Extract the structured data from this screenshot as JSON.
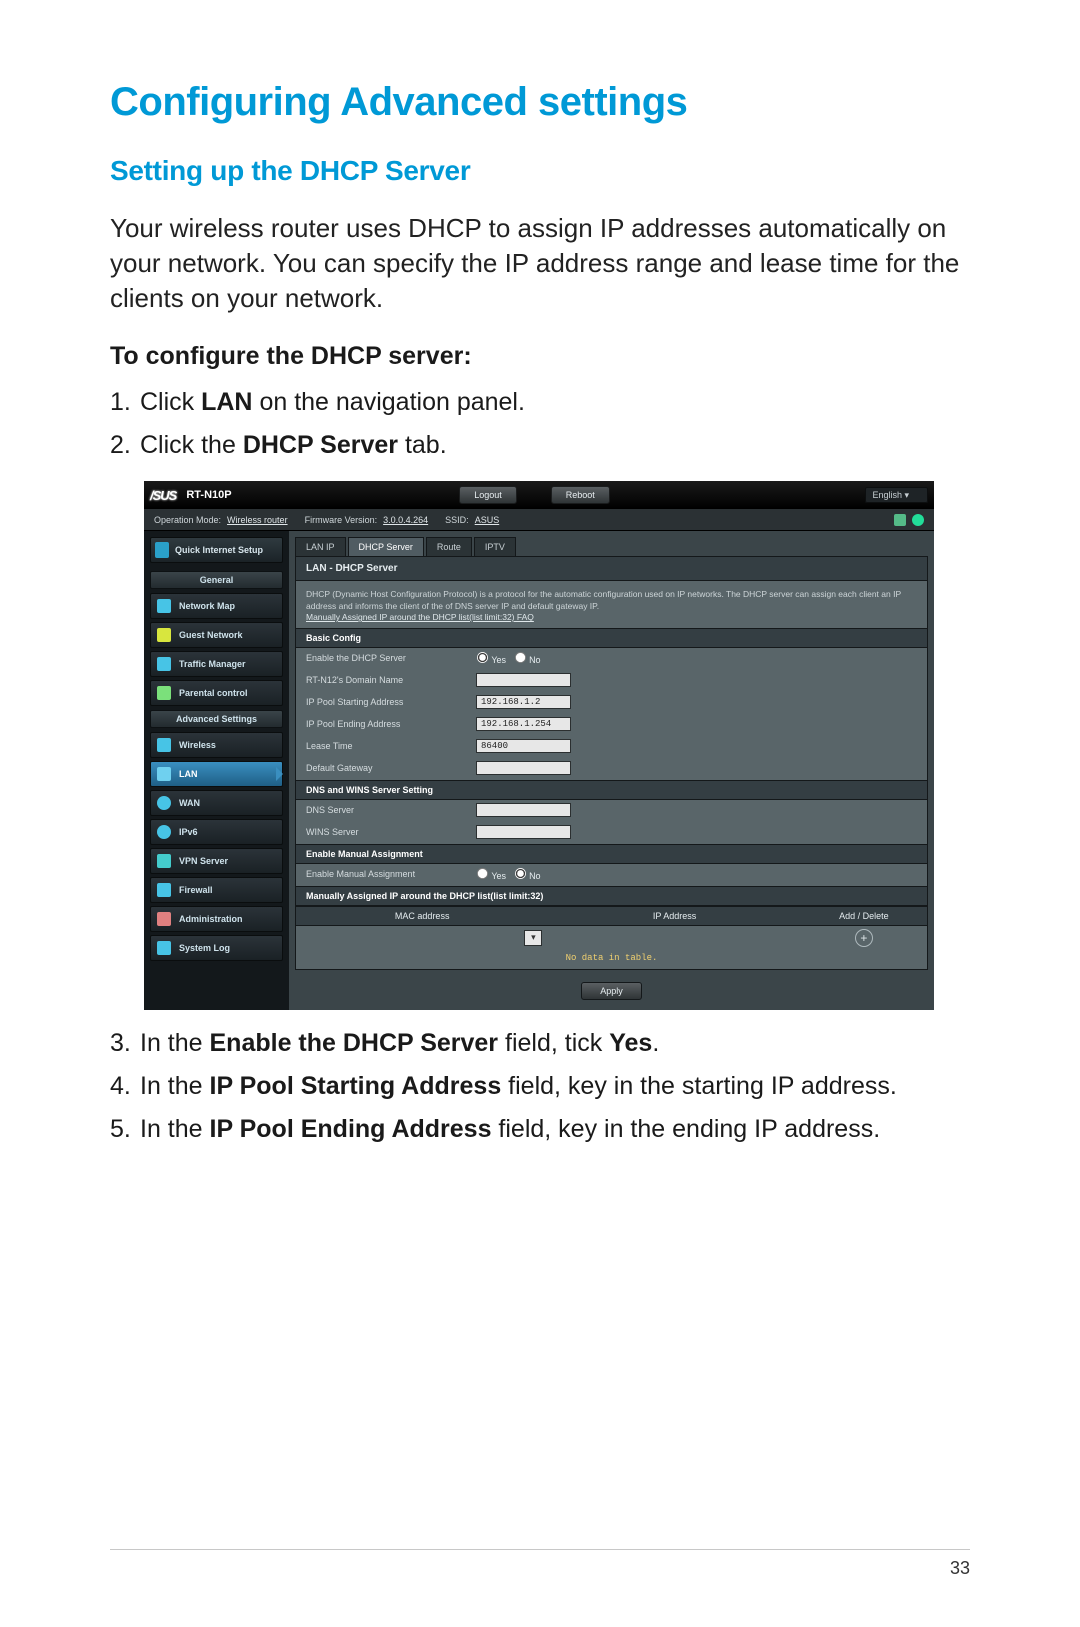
{
  "page": {
    "h1": "Configuring Advanced settings",
    "h2": "Setting up the DHCP Server",
    "intro": "Your wireless router uses DHCP to assign IP addresses automatically on your network. You can specify the IP address range and lease time for the clients on your network.",
    "subhead": "To configure the DHCP server:",
    "step1_pre": "Click ",
    "step1_b": "LAN",
    "step1_post": " on the navigation panel.",
    "step2_pre": "Click the ",
    "step2_b": "DHCP Server",
    "step2_post": " tab.",
    "step3_pre": "In the ",
    "step3_b": "Enable the DHCP Server",
    "step3_mid": " field, tick ",
    "step3_b2": "Yes",
    "step3_post": ".",
    "step4_pre": "In the ",
    "step4_b": "IP Pool Starting Address",
    "step4_post": " field, key in the starting IP address.",
    "step5_pre": "In the ",
    "step5_b": "IP Pool Ending Address",
    "step5_post": " field, key in the ending IP address.",
    "number": "33"
  },
  "router": {
    "logo": "/SUS",
    "model": "RT-N10P",
    "btn_logout": "Logout",
    "btn_reboot": "Reboot",
    "lang": "English",
    "opmode_label": "Operation Mode:",
    "opmode_value": "Wireless router",
    "fw_label": "Firmware Version:",
    "fw_value": "3.0.0.4.264",
    "ssid_label": "SSID:",
    "ssid_value": "ASUS",
    "quick_setup": "Quick Internet Setup",
    "grp_general": "General",
    "grp_advanced": "Advanced Settings",
    "side": {
      "network_map": "Network Map",
      "guest": "Guest Network",
      "traffic": "Traffic Manager",
      "parental": "Parental control",
      "wireless": "Wireless",
      "lan": "LAN",
      "wan": "WAN",
      "ipv6": "IPv6",
      "vpn": "VPN Server",
      "firewall": "Firewall",
      "admin": "Administration",
      "syslog": "System Log"
    },
    "tabs": {
      "lanip": "LAN IP",
      "dhcp": "DHCP Server",
      "route": "Route",
      "iptv": "IPTV"
    },
    "panel_title": "LAN - DHCP Server",
    "desc1": "DHCP (Dynamic Host Configuration Protocol) is a protocol for the automatic configuration used on IP networks. The DHCP server can assign each client an IP address and informs the client of the of DNS server IP and default gateway IP.",
    "desc_link": "Manually Assigned IP around the DHCP list(list limit:32) FAQ",
    "sec_basic": "Basic Config",
    "row_enable": "Enable the DHCP Server",
    "yes": "Yes",
    "no": "No",
    "row_domain": "RT-N12's Domain Name",
    "row_ipstart": "IP Pool Starting Address",
    "val_ipstart": "192.168.1.2",
    "row_ipend": "IP Pool Ending Address",
    "val_ipend": "192.168.1.254",
    "row_lease": "Lease Time",
    "val_lease": "86400",
    "row_gateway": "Default Gateway",
    "sec_dns": "DNS and WINS Server Setting",
    "row_dns": "DNS Server",
    "row_wins": "WINS Server",
    "sec_manual": "Enable Manual Assignment",
    "row_manual": "Enable Manual Assignment",
    "sec_list": "Manually Assigned IP around the DHCP list(list limit:32)",
    "col_mac": "MAC address",
    "col_ip": "IP Address",
    "col_add": "Add / Delete",
    "nodata": "No data in table.",
    "apply": "Apply"
  }
}
